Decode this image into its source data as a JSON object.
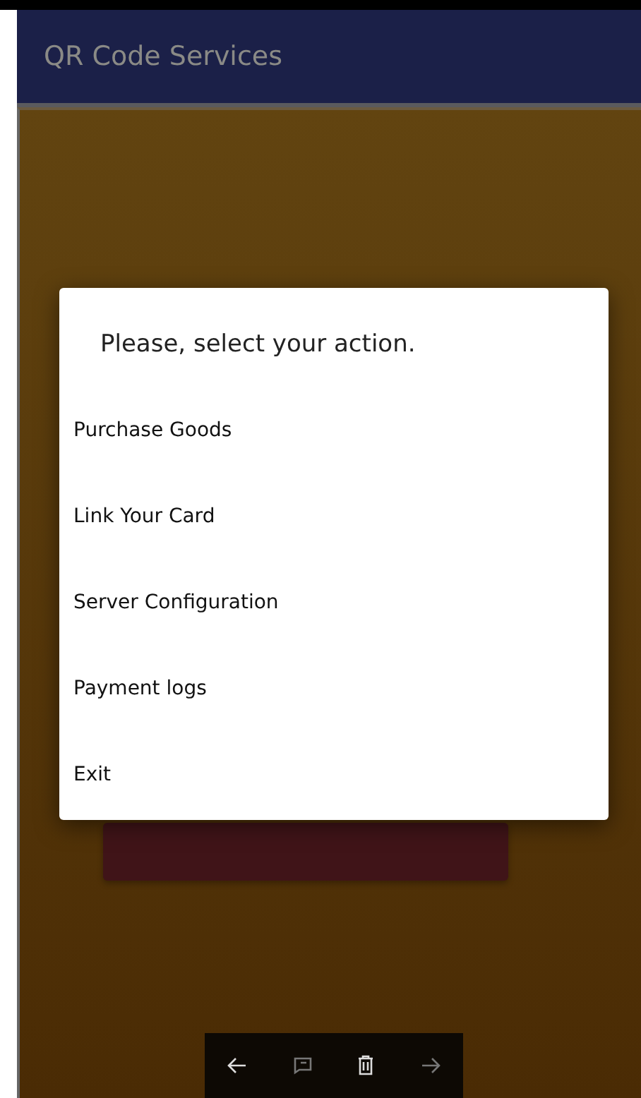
{
  "app_bar": {
    "title": "QR Code Services"
  },
  "dialog": {
    "title": "Please, select your action.",
    "items": [
      {
        "label": "Purchase Goods"
      },
      {
        "label": "Link Your Card"
      },
      {
        "label": "Server Configuration"
      },
      {
        "label": "Payment logs"
      },
      {
        "label": "Exit"
      }
    ]
  },
  "nav_bar": {
    "buttons": [
      {
        "kind": "back",
        "disabled": false
      },
      {
        "kind": "comment",
        "disabled": true
      },
      {
        "kind": "delete",
        "disabled": false
      },
      {
        "kind": "forward",
        "disabled": true
      }
    ]
  }
}
